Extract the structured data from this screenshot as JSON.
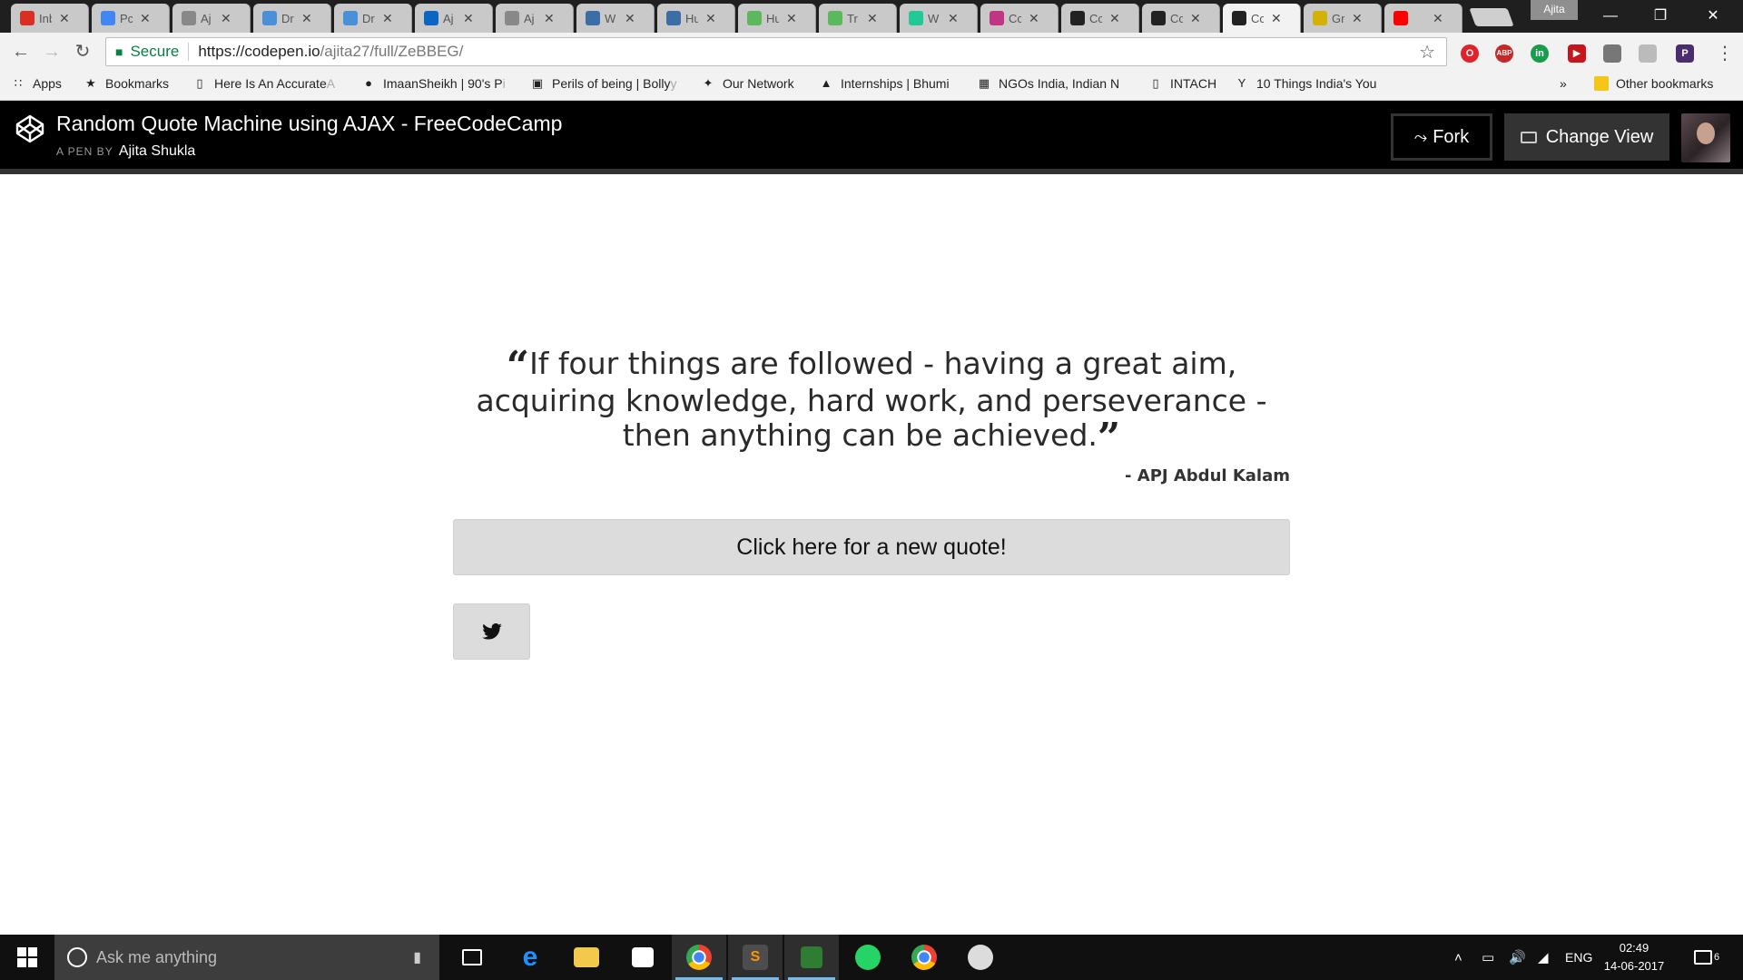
{
  "browser": {
    "tabs": [
      {
        "label": "Inbox",
        "icon": "gmail-icon",
        "color": "#d93025"
      },
      {
        "label": "Pc",
        "icon": "docs-icon",
        "color": "#4285f4"
      },
      {
        "label": "Aj",
        "icon": "document-icon",
        "color": "#888888"
      },
      {
        "label": "Dr",
        "icon": "drive-icon",
        "color": "#4a90d9"
      },
      {
        "label": "Dr",
        "icon": "drive-icon",
        "color": "#4a90d9"
      },
      {
        "label": "Aj",
        "icon": "linkedin-icon",
        "color": "#0a66c2"
      },
      {
        "label": "Aj",
        "icon": "document-icon",
        "color": "#888888"
      },
      {
        "label": "W",
        "icon": "ngo-icon",
        "color": "#3a6ea5"
      },
      {
        "label": "Hu",
        "icon": "ngo-icon",
        "color": "#3a6ea5"
      },
      {
        "label": "Hu",
        "icon": "app-icon",
        "color": "#5cb85c"
      },
      {
        "label": "Tr",
        "icon": "app-icon",
        "color": "#5cb85c"
      },
      {
        "label": "W",
        "icon": "play-icon",
        "color": "#20c997"
      },
      {
        "label": "Cc",
        "icon": "instagram-icon",
        "color": "#c13584"
      },
      {
        "label": "Cc",
        "icon": "codepen-icon",
        "color": "#222222"
      },
      {
        "label": "Cc",
        "icon": "codepen-icon",
        "color": "#222222"
      },
      {
        "label": "Cc",
        "icon": "codepen-icon",
        "color": "#222222"
      },
      {
        "label": "Gr",
        "icon": "grammarly-icon",
        "color": "#d4b106"
      },
      {
        "label": "",
        "icon": "youtube-icon",
        "color": "#ff0000"
      }
    ],
    "active_tab_index": 15,
    "profile_name": "Ajita",
    "secure_label": "Secure",
    "url_host": "https://codepen.io",
    "url_path": "/ajita27/full/ZeBBEG/",
    "bookmarks": [
      {
        "label": "Apps",
        "icon": "apps-grid-icon"
      },
      {
        "label": "Bookmarks",
        "icon": "star-icon"
      },
      {
        "label": "Here Is An Accurate",
        "fade": "A",
        "icon": "page-icon"
      },
      {
        "label": "ImaanSheikh | 90's P",
        "fade": "i",
        "icon": "avatar-icon"
      },
      {
        "label": "Perils of being | Bolly",
        "fade": "y",
        "icon": "image-icon"
      },
      {
        "label": "Our Network",
        "icon": "ngo-icon"
      },
      {
        "label": "Internships | Bhumi",
        "icon": "bhumi-icon"
      },
      {
        "label": "NGOs India, Indian N",
        "icon": "grid-icon"
      },
      {
        "label": "INTACH",
        "icon": "page-icon"
      },
      {
        "label": "10 Things India's You",
        "icon": "ycombinator-icon"
      }
    ],
    "bookmarks_overflow": "»",
    "other_bookmarks": "Other bookmarks"
  },
  "codepen": {
    "title": "Random Quote Machine using AJAX - FreeCodeCamp",
    "byline_prefix": "A PEN BY",
    "author": "Ajita Shukla",
    "fork_label": "Fork",
    "change_view_label": "Change View"
  },
  "quote": {
    "text": "If four things are followed - having a great aim, acquiring knowledge, hard work, and perseverance - then anything can be achieved.",
    "author": "- APJ Abdul Kalam",
    "new_quote_label": "Click here for a new quote!"
  },
  "taskbar": {
    "search_placeholder": "Ask me anything",
    "language": "ENG",
    "time": "02:49",
    "date": "14-06-2017",
    "notifications": "6"
  }
}
